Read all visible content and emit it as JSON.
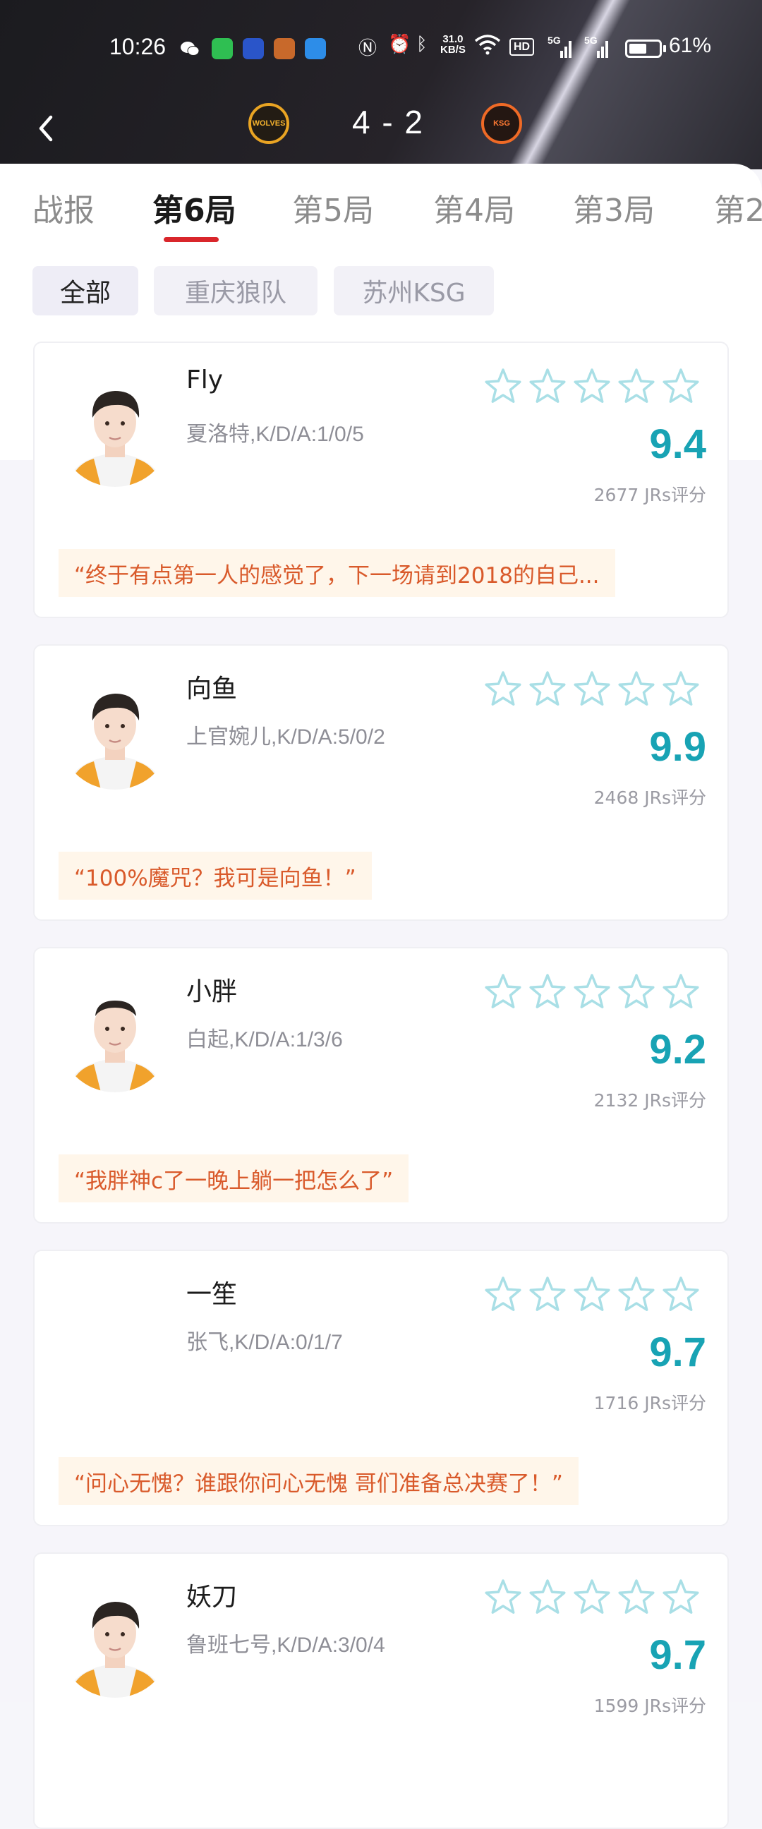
{
  "status_bar": {
    "time": "10:26",
    "net_speed_value": "31.0",
    "net_speed_unit": "KB/S",
    "hd_label": "HD",
    "sig1": "5G",
    "sig2": "5G",
    "battery_percent": "61%",
    "battery_level": 0.61
  },
  "header": {
    "score": "4 - 2",
    "team_left_logo_text": "WOLVES",
    "team_right_logo_text": "KSG"
  },
  "tabs": [
    "战报",
    "第6局",
    "第5局",
    "第4局",
    "第3局",
    "第2"
  ],
  "active_tab": 1,
  "filters": [
    "全部",
    "重庆狼队",
    "苏州KSG"
  ],
  "active_filter": 0,
  "players": [
    {
      "name": "Fly",
      "hero_kda": "夏洛特,K/D/A:1/0/5",
      "rating": "9.4",
      "votes": "2677 JRs评分",
      "quote": "“终于有点第一人的感觉了，下一场请到2018的自己..."
    },
    {
      "name": "向鱼",
      "hero_kda": "上官婉儿,K/D/A:5/0/2",
      "rating": "9.9",
      "votes": "2468 JRs评分",
      "quote": "“100%魔咒？我可是向鱼！”"
    },
    {
      "name": "小胖",
      "hero_kda": "白起,K/D/A:1/3/6",
      "rating": "9.2",
      "votes": "2132 JRs评分",
      "quote": "“我胖神c了一晚上躺一把怎么了”"
    },
    {
      "name": "一笙",
      "hero_kda": "张飞,K/D/A:0/1/7",
      "rating": "9.7",
      "votes": "1716 JRs评分",
      "quote": "“问心无愧？谁跟你问心无愧 哥们准备总决赛了！”"
    },
    {
      "name": "妖刀",
      "hero_kda": "鲁班七号,K/D/A:3/0/4",
      "rating": "9.7",
      "votes": "1599 JRs评分",
      "quote": ""
    }
  ],
  "colors": {
    "accent_red": "#d9262b",
    "rating_teal": "#18a3b4",
    "star_outline": "#a9dfe6",
    "quote_text": "#d95a2b"
  }
}
